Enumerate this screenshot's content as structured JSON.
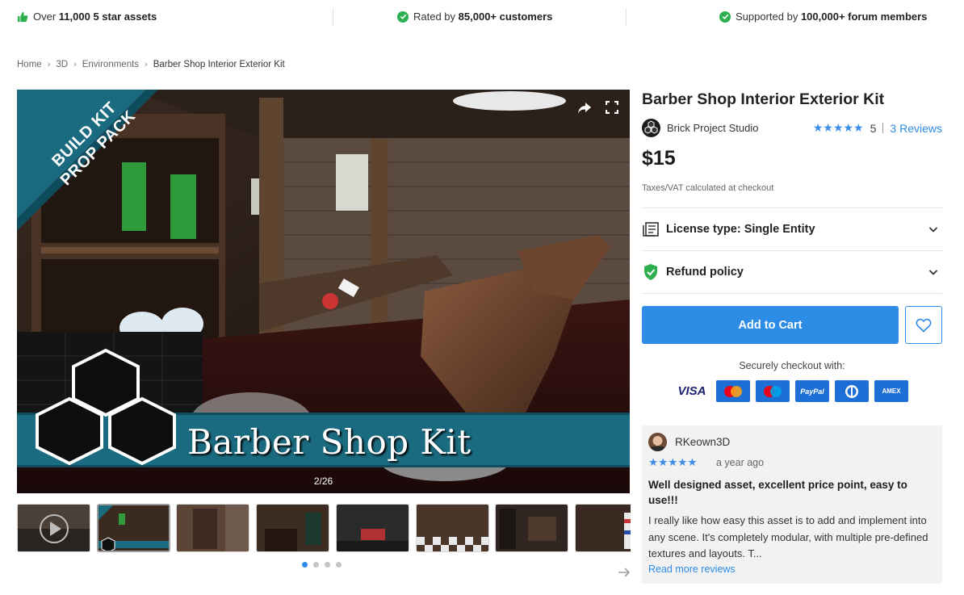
{
  "trust_bar": {
    "item1": {
      "prefix": "Over ",
      "bold": "11,000 5 star assets"
    },
    "item2": {
      "prefix": "Rated by ",
      "bold": "85,000+ customers"
    },
    "item3": {
      "prefix": "Supported by ",
      "bold": "100,000+ forum members"
    }
  },
  "breadcrumb": [
    "Home",
    "3D",
    "Environments",
    "Barber Shop Interior Exterior Kit"
  ],
  "gallery": {
    "ribbon_line1": "BUILD KIT",
    "ribbon_line2": "PROP PACK",
    "banner": "Barber Shop Kit",
    "counter": "2/26",
    "thumbnail_count": 8,
    "active_thumbnail": 2,
    "dots": 4,
    "active_dot": 1
  },
  "product": {
    "title": "Barber Shop Interior Exterior Kit",
    "publisher": "Brick Project Studio",
    "stars": "★★★★★",
    "rating": "5",
    "reviews_link": "3 Reviews",
    "price": "$15",
    "tax_note": "Taxes/VAT calculated at checkout",
    "license_label": "License type: Single Entity",
    "refund_label": "Refund policy",
    "add_to_cart": "Add to Cart",
    "secure_checkout": "Securely checkout with:",
    "payments": [
      "VISA",
      "MC",
      "Maestro",
      "PayPal",
      "Diners",
      "AMEX"
    ]
  },
  "review": {
    "author": "RKeown3D",
    "stars": "★★★★★",
    "date": "a year ago",
    "title": "Well designed asset, excellent price point, easy to use!!!",
    "body": "I really like how easy this asset is to add and implement into any scene.  It's completely modular, with multiple pre-defined textures and layouts.  T...",
    "read_more": "Read more reviews"
  },
  "colors": {
    "accent": "#2d8ce6",
    "star": "#3d8ee8",
    "check_green": "#2eaf4f",
    "ribbon_teal": "#1b6b80"
  }
}
